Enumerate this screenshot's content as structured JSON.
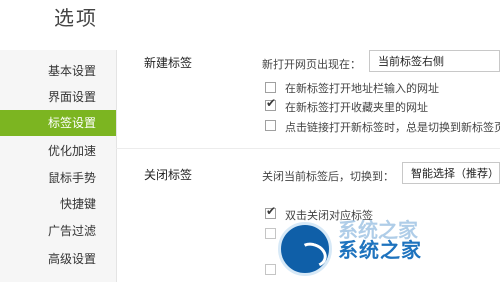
{
  "window": {
    "title": "选项"
  },
  "sidebar": {
    "items": [
      {
        "label": "基本设置",
        "active": false
      },
      {
        "label": "界面设置",
        "active": false
      },
      {
        "label": "标签设置",
        "active": true
      },
      {
        "label": "优化加速",
        "active": false
      },
      {
        "label": "鼠标手势",
        "active": false
      },
      {
        "label": "快捷键",
        "active": false
      },
      {
        "label": "广告过滤",
        "active": false
      },
      {
        "label": "高级设置",
        "active": false
      }
    ]
  },
  "new_tab": {
    "section_label": "新建标签",
    "open_position_label": "新打开网页出现在：",
    "open_position_value": "当前标签右侧",
    "options": [
      {
        "label": "在新标签打开地址栏输入的网址",
        "checked": false
      },
      {
        "label": "在新标签打开收藏夹里的网址",
        "checked": true
      },
      {
        "label": "点击链接打开新标签时，总是切换到新标签页",
        "checked": false
      }
    ]
  },
  "close_tab": {
    "section_label": "关闭标签",
    "switch_label": "关闭当前标签后，切换到：",
    "switch_value": "智能选择（推荐）",
    "options": [
      {
        "label": "双击关闭对应标签",
        "checked": true
      }
    ]
  },
  "watermark": {
    "text": "系统之家",
    "ghost_text": "系统之家"
  },
  "colors": {
    "accent": "#7cb521",
    "watermark_blue": "#1e73be"
  }
}
